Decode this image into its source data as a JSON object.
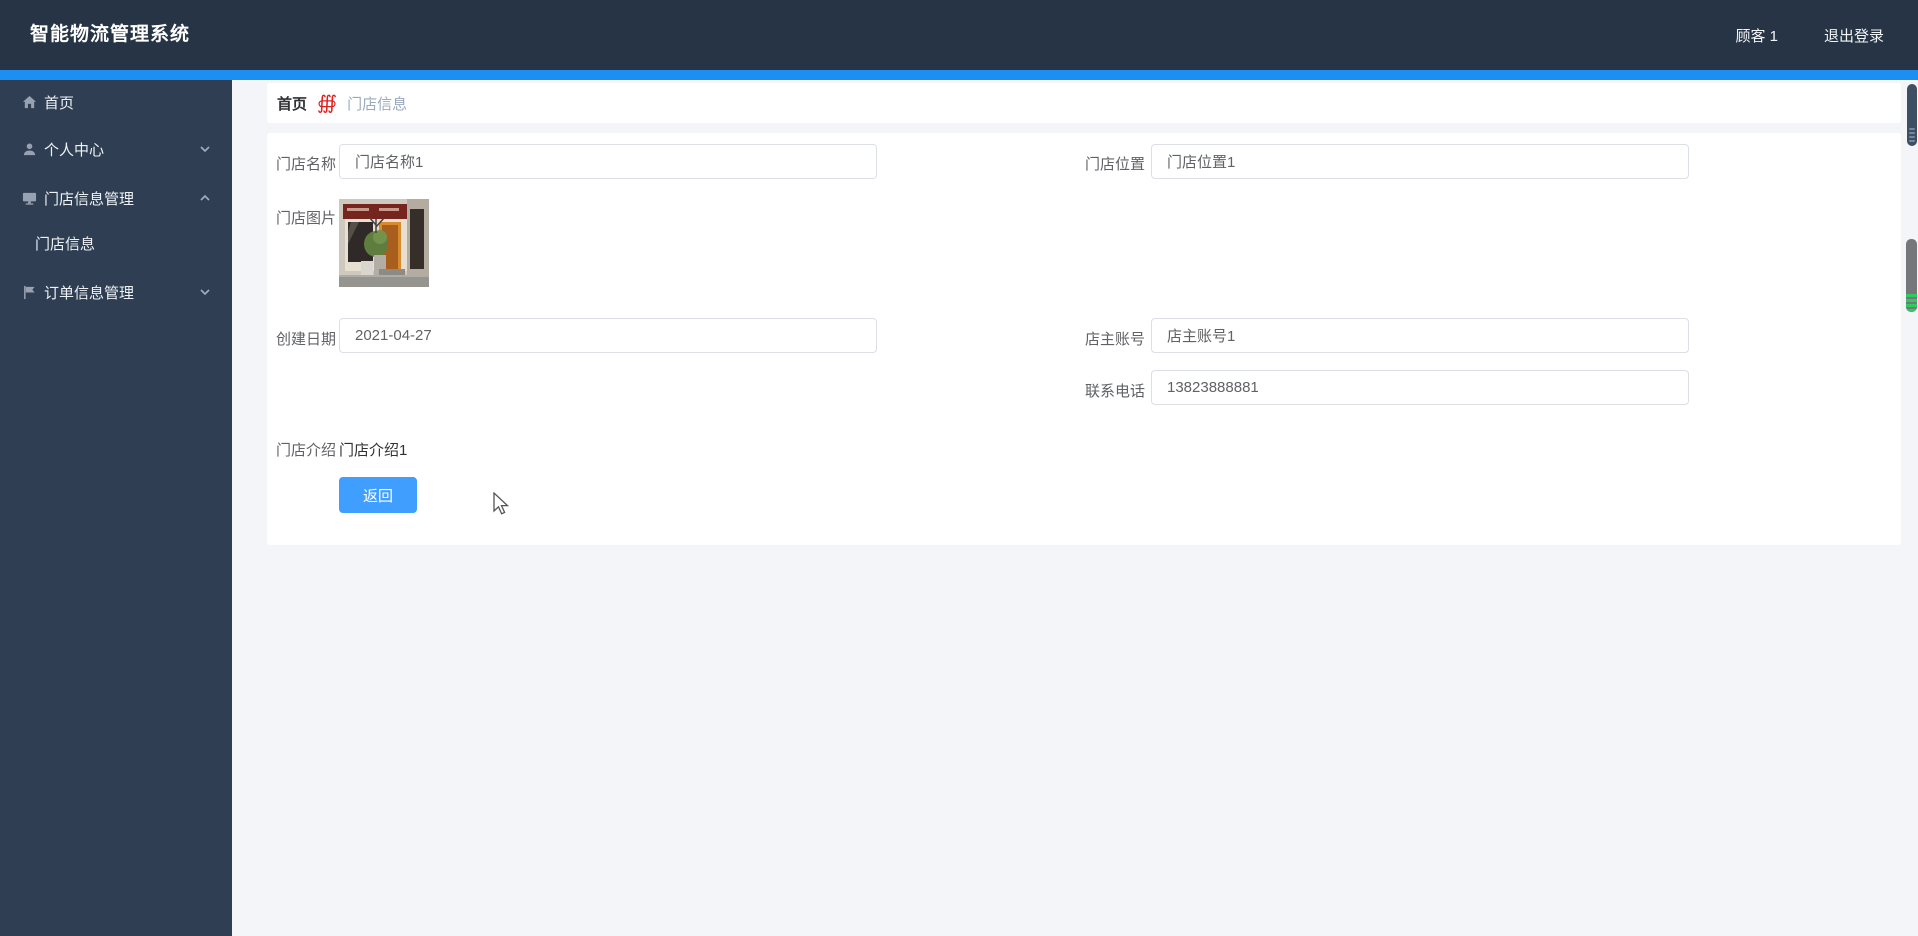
{
  "app": {
    "title": "智能物流管理系统"
  },
  "header": {
    "user_label": "顾客 1",
    "logout_label": "退出登录"
  },
  "sidebar": {
    "items": [
      {
        "label": "首页",
        "icon": "home-icon"
      },
      {
        "label": "个人中心",
        "icon": "user-icon",
        "chevron": "down"
      },
      {
        "label": "门店信息管理",
        "icon": "monitor-icon",
        "chevron": "up",
        "expanded": true
      },
      {
        "label": "门店信息",
        "icon": null,
        "submenu_of": "门店信息管理"
      },
      {
        "label": "订单信息管理",
        "icon": "flag-icon",
        "chevron": "down"
      }
    ]
  },
  "breadcrumb": {
    "home": "首页",
    "separator": "∰",
    "current": "门店信息"
  },
  "form": {
    "store_name": {
      "label": "门店名称",
      "value": "门店名称1"
    },
    "store_location": {
      "label": "门店位置",
      "value": "门店位置1"
    },
    "store_image": {
      "label": "门店图片",
      "image": "storefront-photo"
    },
    "create_date": {
      "label": "创建日期",
      "value": "2021-04-27"
    },
    "owner_account": {
      "label": "店主账号",
      "value": "店主账号1"
    },
    "contact_phone": {
      "label": "联系电话",
      "value": "13823888881"
    },
    "store_intro": {
      "label": "门店介绍",
      "value": "门店介绍1"
    },
    "back_button": "返回"
  },
  "colors": {
    "header_bg": "#263445",
    "sidebar_bg": "#2f3e52",
    "accent_strip": "#1d8ff2",
    "button_blue": "#409eff",
    "breadcrumb_separator_red": "#e01f1f",
    "scroll_green": "#2ecc5e",
    "content_bg": "#f3f5f9"
  }
}
